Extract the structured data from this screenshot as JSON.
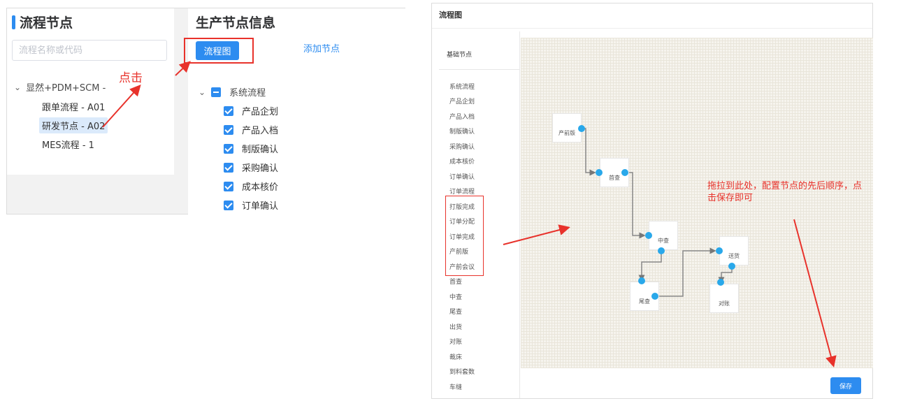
{
  "left": {
    "tree_panel": {
      "title": "流程节点",
      "search_placeholder": "流程名称或代码",
      "root": "显然+PDM+SCM -",
      "children": [
        "跟单流程 - A01",
        "研发节点 - A02",
        "MES流程 - 1"
      ]
    },
    "info_panel": {
      "title": "生产节点信息",
      "flow_button": "流程图",
      "add_node": "添加节点",
      "group": "系统流程",
      "items": [
        "产品企划",
        "产品入档",
        "制版确认",
        "采购确认",
        "成本核价",
        "订单确认"
      ]
    },
    "annotation_click": "点击"
  },
  "right": {
    "title": "流程图",
    "node_list_title": "基础节点",
    "nodes": [
      "系统流程",
      "产品企划",
      "产品入档",
      "制版确认",
      "采购确认",
      "成本核价",
      "订单确认",
      "订单流程",
      "打版完成",
      "订单分配",
      "订单完成",
      "产前版",
      "产前会议",
      "首查",
      "中查",
      "尾查",
      "出货",
      "对账",
      "裁床",
      "到料套数",
      "车缝"
    ],
    "flow_nodes": [
      "产前版",
      "首查",
      "中查",
      "尾查",
      "送货",
      "对账"
    ],
    "save_button": "保存",
    "annotation_drag": "拖拉到此处，配置节点的先后顺序，点击保存即可",
    "colors": {
      "accent": "#2d8cf0",
      "port": "#29a8ea",
      "annotation": "#e8322b"
    }
  }
}
